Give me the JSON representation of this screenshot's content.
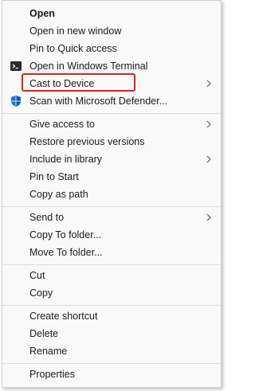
{
  "menu": {
    "items": [
      {
        "label": "Open"
      },
      {
        "label": "Open in new window"
      },
      {
        "label": "Pin to Quick access"
      },
      {
        "label": "Open in Windows Terminal",
        "icon": "terminal-icon"
      },
      {
        "label": "Cast to Device",
        "submenu": true
      },
      {
        "label": "Scan with Microsoft Defender...",
        "icon": "defender-shield-icon"
      },
      {
        "label": "Give access to",
        "submenu": true
      },
      {
        "label": "Restore previous versions"
      },
      {
        "label": "Include in library",
        "submenu": true
      },
      {
        "label": "Pin to Start"
      },
      {
        "label": "Copy as path"
      },
      {
        "label": "Send to",
        "submenu": true
      },
      {
        "label": "Copy To folder..."
      },
      {
        "label": "Move To folder..."
      },
      {
        "label": "Cut"
      },
      {
        "label": "Copy"
      },
      {
        "label": "Create shortcut"
      },
      {
        "label": "Delete"
      },
      {
        "label": "Rename"
      },
      {
        "label": "Properties"
      }
    ]
  },
  "colors": {
    "highlight_border": "#e0201b",
    "defender_blue": "#1a73d9"
  }
}
